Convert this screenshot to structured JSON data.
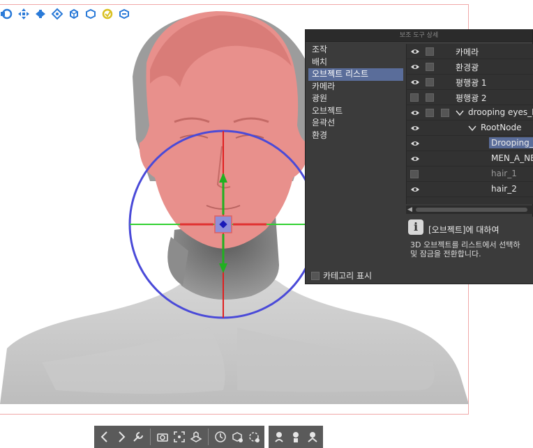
{
  "panel": {
    "title": "보조 도구 상세",
    "categories": [
      "조작",
      "배치",
      "오브젝트 리스트",
      "카메라",
      "광원",
      "오브젝트",
      "윤곽선",
      "환경"
    ],
    "selected_category": "오브젝트 리스트",
    "show_category_label": "카테고리 표시"
  },
  "objects": [
    {
      "name": "카메라",
      "visible": true
    },
    {
      "name": "환경광",
      "visible": true
    },
    {
      "name": "평행광 1",
      "visible": true
    },
    {
      "name": "평행광 2",
      "visible": false
    },
    {
      "name": "drooping eyes_H",
      "visible": true
    },
    {
      "name": "RootNode",
      "visible": true
    },
    {
      "name": "Drooping_e",
      "visible": true,
      "selected": true
    },
    {
      "name": "MEN_A_NE",
      "visible": true
    },
    {
      "name": "hair_1",
      "visible": false
    },
    {
      "name": "hair_2",
      "visible": true
    }
  ],
  "info": {
    "title": "[오브젝트]에 대하여",
    "line1": "3D 오브젝트를 리스트에서 선택하",
    "line2": "및 잠금을 전환합니다."
  },
  "icons": {
    "top_toolbar": [
      "rotate-icon",
      "pan-icon",
      "move-icon",
      "move-3d-icon",
      "rotate-3d-icon",
      "scale-3d-icon",
      "snap-icon",
      "reset-icon"
    ],
    "bottom_toolbar": [
      "prev-icon",
      "next-icon",
      "wrench-icon",
      "camera-icon",
      "fit-icon",
      "floor-icon",
      "reset-angle-icon",
      "object-reset-icon",
      "rotate-reset-icon",
      "pose-a-icon",
      "pose-b-icon",
      "pose-c-icon"
    ]
  },
  "colors": {
    "accent_selection": "#5a6d9a",
    "head_highlight": "#e88a8a",
    "gizmo_ring": "#4a4ad8",
    "axis_x": "#e02020",
    "axis_y": "#20c020",
    "axis_z": "#20c020"
  }
}
